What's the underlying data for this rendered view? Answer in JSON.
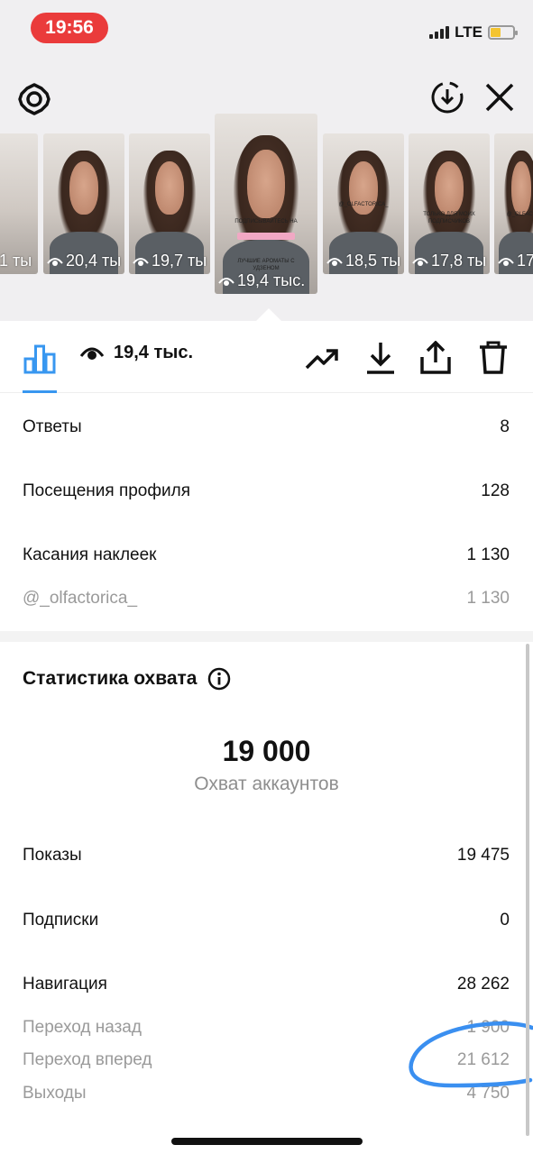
{
  "status_bar": {
    "time": "19:56",
    "network": "LTE"
  },
  "toolbar": {
    "settings_icon": "gear-icon",
    "download_icon": "download-circle-icon",
    "close_icon": "close-icon"
  },
  "thumbnails": [
    {
      "views": ",1 ты"
    },
    {
      "views": "20,4 ты"
    },
    {
      "views": "19,7 ты"
    },
    {
      "views": "19,4 тыс.",
      "caption": "ПОДПИСЫВАЙТЕСЬ НА",
      "caption2": "ЛУЧШИЕ АРОМАТЫ С УДЗЕНОМ"
    },
    {
      "views": "18,5 ты",
      "caption": "@_OLFACTORICA_"
    },
    {
      "views": "17,8 ты",
      "caption": "ТОЛЬКО ДЛЯ МОИХ ПОДПИСЧИКОВ"
    },
    {
      "views": "17,",
      "caption": "@_OLFACT"
    }
  ],
  "action_bar": {
    "insights_icon": "bar-chart-icon",
    "views_icon": "eye-icon",
    "views_value": "19,4 тыс.",
    "trend_icon": "trending-up-icon",
    "download_icon": "download-icon",
    "share_icon": "share-icon",
    "delete_icon": "trash-icon"
  },
  "stats_top": [
    {
      "label": "Ответы",
      "value": "8"
    },
    {
      "label": "Посещения профиля",
      "value": "128"
    },
    {
      "label": "Касания наклеек",
      "value": "1 130"
    },
    {
      "label": "@_olfactorica_",
      "value": "1 130"
    }
  ],
  "reach": {
    "title": "Статистика охвата",
    "info_icon": "info-icon",
    "accounts_reached": "19 000",
    "accounts_reached_label": "Охват аккаунтов"
  },
  "stats_reach": [
    {
      "label": "Показы",
      "value": "19 475"
    },
    {
      "label": "Подписки",
      "value": "0"
    },
    {
      "label": "Навигация",
      "value": "28 262"
    },
    {
      "label": "Переход назад",
      "value": "1 900"
    },
    {
      "label": "Переход вперед",
      "value": "21 612"
    },
    {
      "label": "Выходы",
      "value": "4 750"
    }
  ],
  "colors": {
    "accent": "#3897f0",
    "status_time_bg": "#ea3b3b",
    "annotation": "#3a8ff0",
    "battery": "#f4c430"
  }
}
